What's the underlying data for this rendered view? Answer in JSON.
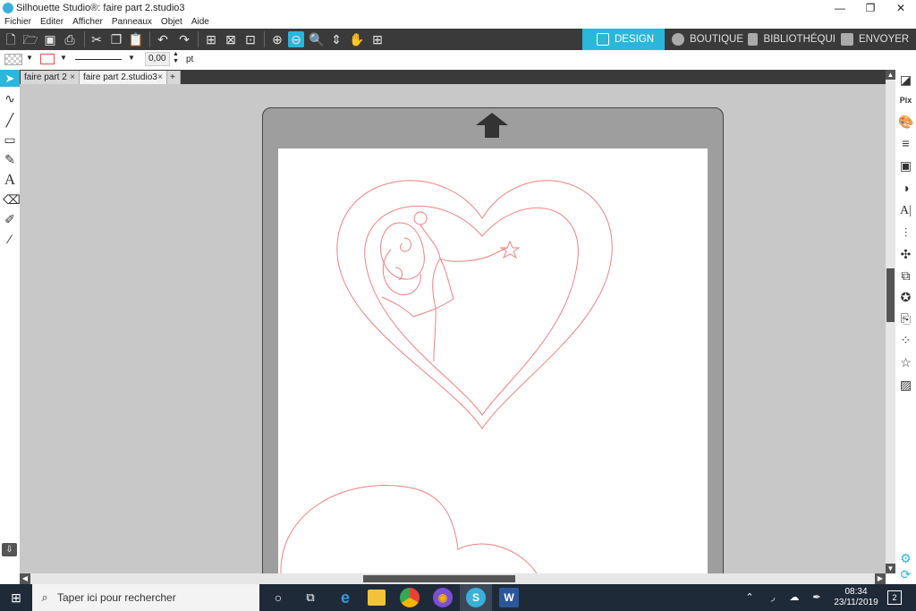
{
  "window": {
    "title": "Silhouette Studio®: faire part 2.studio3",
    "minimize": "—",
    "maximize": "❐",
    "close": "✕"
  },
  "menu": [
    "Fichier",
    "Editer",
    "Afficher",
    "Panneaux",
    "Objet",
    "Aide"
  ],
  "nav_tabs": {
    "design": "DESIGN",
    "boutique": "BOUTIQUE",
    "bibliotheque": "BIBLIOTHÉQUI",
    "envoyer": "ENVOYER"
  },
  "properties": {
    "line_width_value": "0,00",
    "line_width_unit": "pt"
  },
  "doc_tabs": [
    {
      "label": "faire part 2",
      "active": false
    },
    {
      "label": "faire part 2.studio3",
      "active": true
    }
  ],
  "add_tab": "+",
  "taskbar": {
    "search_placeholder": "Taper ici pour rechercher",
    "time": "08:34",
    "date": "23/11/2019",
    "notifications": "2"
  },
  "colors": {
    "accent": "#2bb6dc",
    "toolbar": "#3a3a3a",
    "cut_line": "#f08080",
    "taskbar": "#1f2a38"
  }
}
